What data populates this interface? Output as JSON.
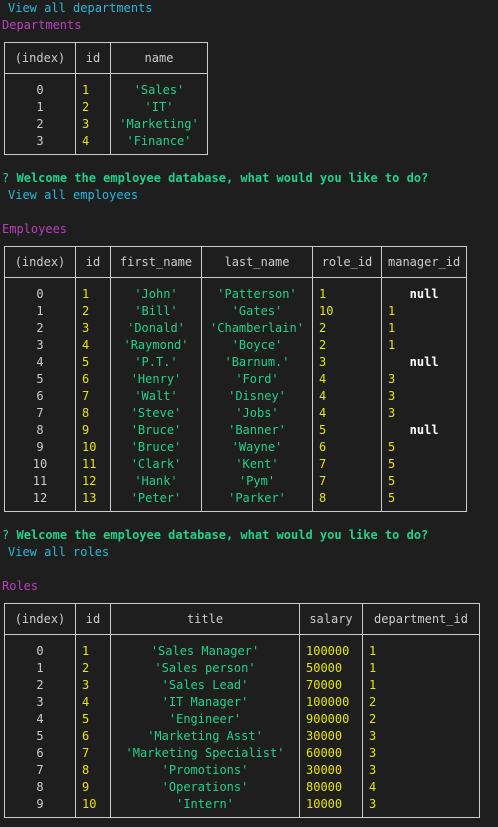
{
  "prompt": {
    "question_mark": "?",
    "question": "Welcome the employee database, what would you like to do?"
  },
  "commands": {
    "c1": "View all departments",
    "c2": "View all employees",
    "c3": "View all roles"
  },
  "departments": {
    "title": "Departments",
    "columns": [
      "(index)",
      "id",
      "name"
    ],
    "rows": [
      [
        "0",
        "1",
        "'Sales'"
      ],
      [
        "1",
        "2",
        "'IT'"
      ],
      [
        "2",
        "3",
        "'Marketing'"
      ],
      [
        "3",
        "4",
        "'Finance'"
      ]
    ]
  },
  "employees": {
    "title": "Employees",
    "columns": [
      "(index)",
      "id",
      "first_name",
      "last_name",
      "role_id",
      "manager_id"
    ],
    "rows": [
      [
        "0",
        "1",
        "'John'",
        "'Patterson'",
        "1",
        "null"
      ],
      [
        "1",
        "2",
        "'Bill'",
        "'Gates'",
        "10",
        "1"
      ],
      [
        "2",
        "3",
        "'Donald'",
        "'Chamberlain'",
        "2",
        "1"
      ],
      [
        "3",
        "4",
        "'Raymond'",
        "'Boyce'",
        "2",
        "1"
      ],
      [
        "4",
        "5",
        "'P.T.'",
        "'Barnum.'",
        "3",
        "null"
      ],
      [
        "5",
        "6",
        "'Henry'",
        "'Ford'",
        "4",
        "3"
      ],
      [
        "6",
        "7",
        "'Walt'",
        "'Disney'",
        "4",
        "3"
      ],
      [
        "7",
        "8",
        "'Steve'",
        "'Jobs'",
        "4",
        "3"
      ],
      [
        "8",
        "9",
        "'Bruce'",
        "'Banner'",
        "5",
        "null"
      ],
      [
        "9",
        "10",
        "'Bruce'",
        "'Wayne'",
        "6",
        "5"
      ],
      [
        "10",
        "11",
        "'Clark'",
        "'Kent'",
        "7",
        "5"
      ],
      [
        "11",
        "12",
        "'Hank'",
        "'Pym'",
        "7",
        "5"
      ],
      [
        "12",
        "13",
        "'Peter'",
        "'Parker'",
        "8",
        "5"
      ]
    ]
  },
  "roles": {
    "title": "Roles",
    "columns": [
      "(index)",
      "id",
      "title",
      "salary",
      "department_id"
    ],
    "rows": [
      [
        "0",
        "1",
        "'Sales Manager'",
        "100000",
        "1"
      ],
      [
        "1",
        "2",
        "'Sales person'",
        "50000",
        "1"
      ],
      [
        "2",
        "3",
        "'Sales Lead'",
        "70000",
        "1"
      ],
      [
        "3",
        "4",
        "'IT Manager'",
        "100000",
        "2"
      ],
      [
        "4",
        "5",
        "'Engineer'",
        "900000",
        "2"
      ],
      [
        "5",
        "6",
        "'Marketing Asst'",
        "30000",
        "3"
      ],
      [
        "6",
        "7",
        "'Marketing Specialist'",
        "60000",
        "3"
      ],
      [
        "7",
        "8",
        "'Promotions'",
        "30000",
        "3"
      ],
      [
        "8",
        "9",
        "'Operations'",
        "80000",
        "4"
      ],
      [
        "9",
        "10",
        "'Intern'",
        "10000",
        "3"
      ]
    ]
  },
  "colors": {
    "background": "#1e1e1e",
    "command": "#29b8db",
    "section_title": "#bc3fbc",
    "string_value": "#23d18b",
    "number_value": "#e5e510",
    "null_value": "#ffffff",
    "text": "#cccccc"
  }
}
